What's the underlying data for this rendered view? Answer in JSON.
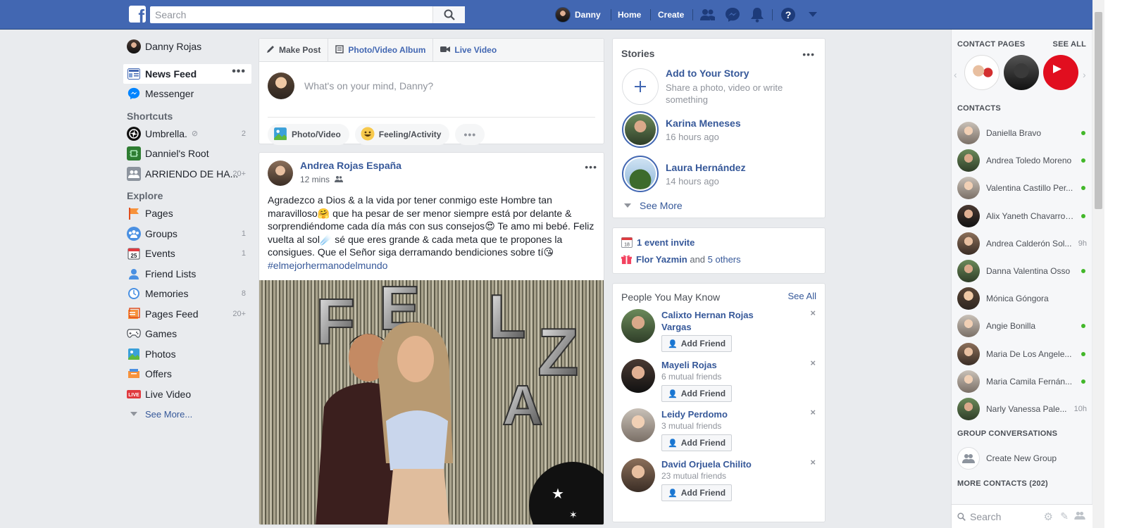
{
  "topbar": {
    "search_placeholder": "Search",
    "user_name": "Danny",
    "home": "Home",
    "create": "Create"
  },
  "left_nav": {
    "profile_name": "Danny Rojas",
    "news_feed": "News Feed",
    "messenger": "Messenger",
    "shortcuts_heading": "Shortcuts",
    "shortcuts": [
      {
        "label": "Umbrella.",
        "count": "2"
      },
      {
        "label": "Danniel's Root",
        "count": ""
      },
      {
        "label": "ARRIENDO DE HA...",
        "count": "20+"
      }
    ],
    "explore_heading": "Explore",
    "explore": [
      {
        "label": "Pages",
        "count": "",
        "icon": "flag-icon"
      },
      {
        "label": "Groups",
        "count": "1",
        "icon": "groups-icon"
      },
      {
        "label": "Events",
        "count": "1",
        "icon": "calendar-icon"
      },
      {
        "label": "Friend Lists",
        "count": "",
        "icon": "friend-list-icon"
      },
      {
        "label": "Memories",
        "count": "8",
        "icon": "clock-icon"
      },
      {
        "label": "Pages Feed",
        "count": "20+",
        "icon": "pages-feed-icon"
      },
      {
        "label": "Games",
        "count": "",
        "icon": "gamepad-icon"
      },
      {
        "label": "Photos",
        "count": "",
        "icon": "photos-icon"
      },
      {
        "label": "Offers",
        "count": "",
        "icon": "offers-icon"
      },
      {
        "label": "Live Video",
        "count": "",
        "icon": "live-icon"
      }
    ],
    "see_more": "See More..."
  },
  "composer": {
    "tab_make_post": "Make Post",
    "tab_album": "Photo/Video Album",
    "tab_live": "Live Video",
    "placeholder": "What's on your mind, Danny?",
    "action_photo": "Photo/Video",
    "action_feeling": "Feeling/Activity"
  },
  "post": {
    "author": "Andrea Rojas España",
    "time": "12 mins",
    "text_1": "Agradezco a Dios & a la vida por tener conmigo este Hombre tan maravilloso",
    "emoji_1": "🤗",
    "text_2": " que ha pesar de ser menor siempre está por delante & sorprendiéndome cada día más con sus consejos",
    "emoji_2": "😍",
    "text_3": " Te amo mi bebé. Feliz vuelta al sol",
    "emoji_3": "☄️",
    "text_4": " sé que eres grande & cada meta que te propones la consigues. Que el Señor siga derramando bendiciones sobre tí",
    "emoji_4": "😘",
    "hashtag": "#elmejorhermanodelmundo"
  },
  "stories": {
    "title": "Stories",
    "add_title": "Add to Your Story",
    "add_sub": "Share a photo, video or write something",
    "items": [
      {
        "name": "Karina Meneses",
        "time": "16 hours ago"
      },
      {
        "name": "Laura Hernández",
        "time": "14 hours ago"
      }
    ],
    "see_more": "See More"
  },
  "events": {
    "calendar_day": "18",
    "invite": "1 event invite",
    "birthday_name": "Flor Yazmin",
    "birthday_and": " and ",
    "birthday_others": "5 others"
  },
  "pymk": {
    "title": "People You May Know",
    "see_all": "See All",
    "add_friend": "Add Friend",
    "people": [
      {
        "name": "Calixto Hernan Rojas Vargas",
        "mutual": ""
      },
      {
        "name": "Mayeli Rojas",
        "mutual": "6 mutual friends"
      },
      {
        "name": "Leidy Perdomo",
        "mutual": "3 mutual friends"
      },
      {
        "name": "David Orjuela Chilito",
        "mutual": "23 mutual friends"
      }
    ]
  },
  "chat": {
    "contact_pages": "CONTACT PAGES",
    "see_all": "SEE ALL",
    "contacts_heading": "CONTACTS",
    "contacts": [
      {
        "name": "Daniella Bravo",
        "status": "online",
        "ago": ""
      },
      {
        "name": "Andrea Toledo Moreno",
        "status": "online",
        "ago": ""
      },
      {
        "name": "Valentina Castillo Per...",
        "status": "online",
        "ago": ""
      },
      {
        "name": "Alix Yaneth Chavarro ...",
        "status": "online",
        "ago": ""
      },
      {
        "name": "Andrea Calderón Sol...",
        "status": "away",
        "ago": "9h"
      },
      {
        "name": "Danna Valentina Osso",
        "status": "online",
        "ago": ""
      },
      {
        "name": "Mónica Góngora",
        "status": "offline",
        "ago": ""
      },
      {
        "name": "Angie Bonilla",
        "status": "online",
        "ago": ""
      },
      {
        "name": "Maria De Los Angele...",
        "status": "online",
        "ago": ""
      },
      {
        "name": "Maria Camila Fernán...",
        "status": "online",
        "ago": ""
      },
      {
        "name": "Narly Vanessa Pale...",
        "status": "away",
        "ago": "10h"
      }
    ],
    "group_heading": "GROUP CONVERSATIONS",
    "create_group": "Create New Group",
    "more_contacts": "MORE CONTACTS (202)",
    "search_placeholder": "Search"
  },
  "colors": {
    "brand_blue": "#4267b2",
    "link_blue": "#365899",
    "online_green": "#42b72a",
    "page_bg": "#e9ebee"
  }
}
